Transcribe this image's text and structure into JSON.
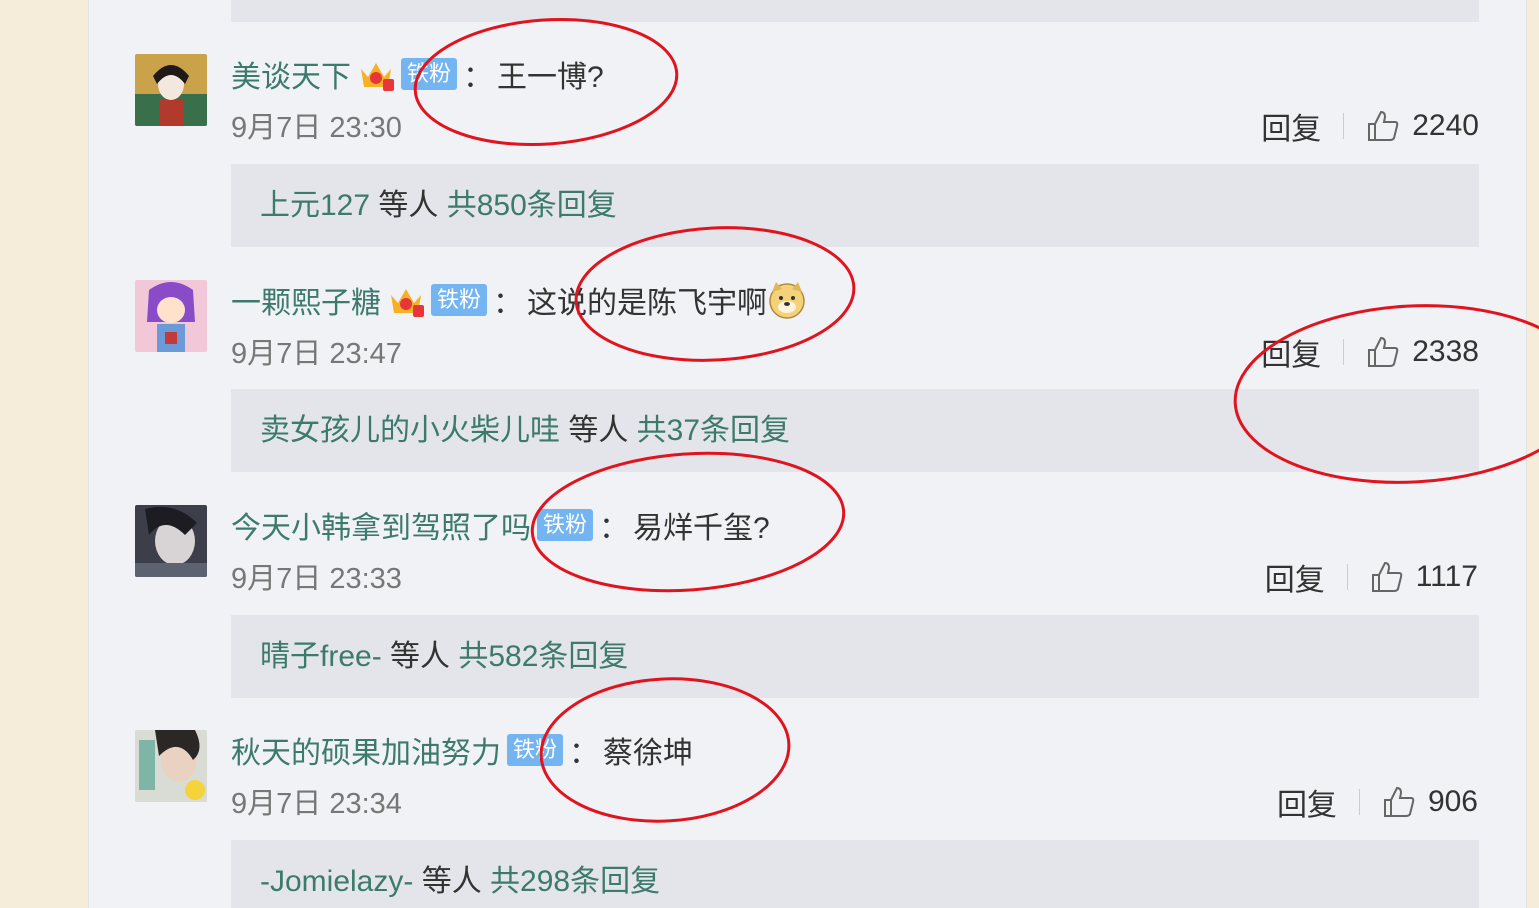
{
  "comments": [
    {
      "username": "美谈天下",
      "badge": "铁粉",
      "colon": "：",
      "text": "王一博?",
      "time": "9月7日 23:30",
      "reply_label": "回复",
      "likes": "2240",
      "replies_user": "上元127",
      "replies_mid": " 等人 ",
      "replies_count": "共850条回复"
    },
    {
      "username": "一颗熙子糖",
      "badge": "铁粉",
      "colon": "：",
      "text": "这说的是陈飞宇啊",
      "time": "9月7日 23:47",
      "reply_label": "回复",
      "likes": "2338",
      "replies_user": "卖女孩儿的小火柴儿哇",
      "replies_mid": " 等人 ",
      "replies_count": "共37条回复"
    },
    {
      "username": "今天小韩拿到驾照了吗",
      "badge": "铁粉",
      "colon": "：",
      "text": "易烊千玺?",
      "time": "9月7日 23:33",
      "reply_label": "回复",
      "likes": "1117",
      "replies_user": "晴子free-",
      "replies_mid": " 等人 ",
      "replies_count": "共582条回复"
    },
    {
      "username": "秋天的硕果加油努力",
      "badge": "铁粉",
      "colon": "：",
      "text": "蔡徐坤",
      "time": "9月7日 23:34",
      "reply_label": "回复",
      "likes": "906",
      "replies_user": "-Jomielazy-",
      "replies_mid": " 等人 ",
      "replies_count": "共298条回复"
    }
  ],
  "colors": {
    "username": "#3d7a6e",
    "badge_bg": "#74b4f0",
    "annotation": "#e0141e",
    "panel_bg": "#f1f2f6",
    "reply_bg": "#e4e5ea"
  }
}
